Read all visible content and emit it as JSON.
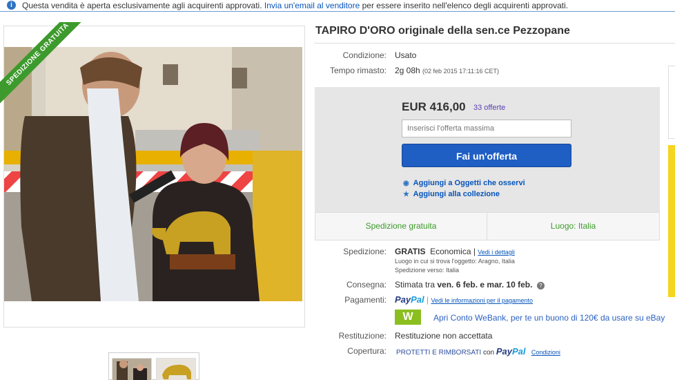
{
  "notice": {
    "text_before": "Questa vendita è aperta esclusivamente agli acquirenti approvati.",
    "link": "Invia un'email al venditore",
    "text_after": "per essere inserito nell'elenco degli acquirenti approvati."
  },
  "image": {
    "ribbon": "SPEDIZIONE GRATUITA"
  },
  "item": {
    "title": "TAPIRO D'ORO originale della sen.ce Pezzopane",
    "condition_label": "Condizione:",
    "condition_value": "Usato",
    "time_label": "Tempo rimasto:",
    "time_value": "2g 08h",
    "time_detail": "(02 feb 2015   17:11:16 CET)"
  },
  "bid": {
    "price": "EUR 416,00",
    "offers": "33 offerte",
    "input_placeholder": "Inserisci l'offerta massima",
    "button": "Fai un'offerta",
    "watch_link": "Aggiungi a Oggetti che osservi",
    "collection_link": "Aggiungi alla collezione"
  },
  "summary": {
    "shipping": "Spedizione gratuita",
    "location": "Luogo: Italia"
  },
  "details": {
    "shipping_label": "Spedizione:",
    "shipping_free": "GRATIS",
    "shipping_type": "Economica |",
    "shipping_details_link": "Vedi i dettagli",
    "item_location": "Luogo in cui si trova l'oggetto:  Aragno, Italia",
    "ships_to": "Spedizione verso:  Italia",
    "delivery_label": "Consegna:",
    "delivery_prefix": "Stimata tra",
    "delivery_dates": "ven. 6 feb. e mar. 10 feb.",
    "payments_label": "Pagamenti:",
    "paypal_a": "Pay",
    "paypal_b": "Pal",
    "payment_info_link": "Vedi le informazioni per il pagamento",
    "webank_logo": "W",
    "webank_text": "Apri Conto WeBank, per te un buono di 120€ da usare su eBay",
    "returns_label": "Restituzione:",
    "returns_value": "Restituzione non accettata",
    "coverage_label": "Copertura:",
    "coverage_text": "PROTETTI E RIMBORSATI",
    "coverage_with": "con",
    "conditions_link": "Condizioni"
  },
  "colors": {
    "accent_blue": "#1f5ec3",
    "free_ship_green": "#3c9a2a",
    "offers_purple": "#5b3fb3",
    "webank_green": "#8bbf1f"
  }
}
